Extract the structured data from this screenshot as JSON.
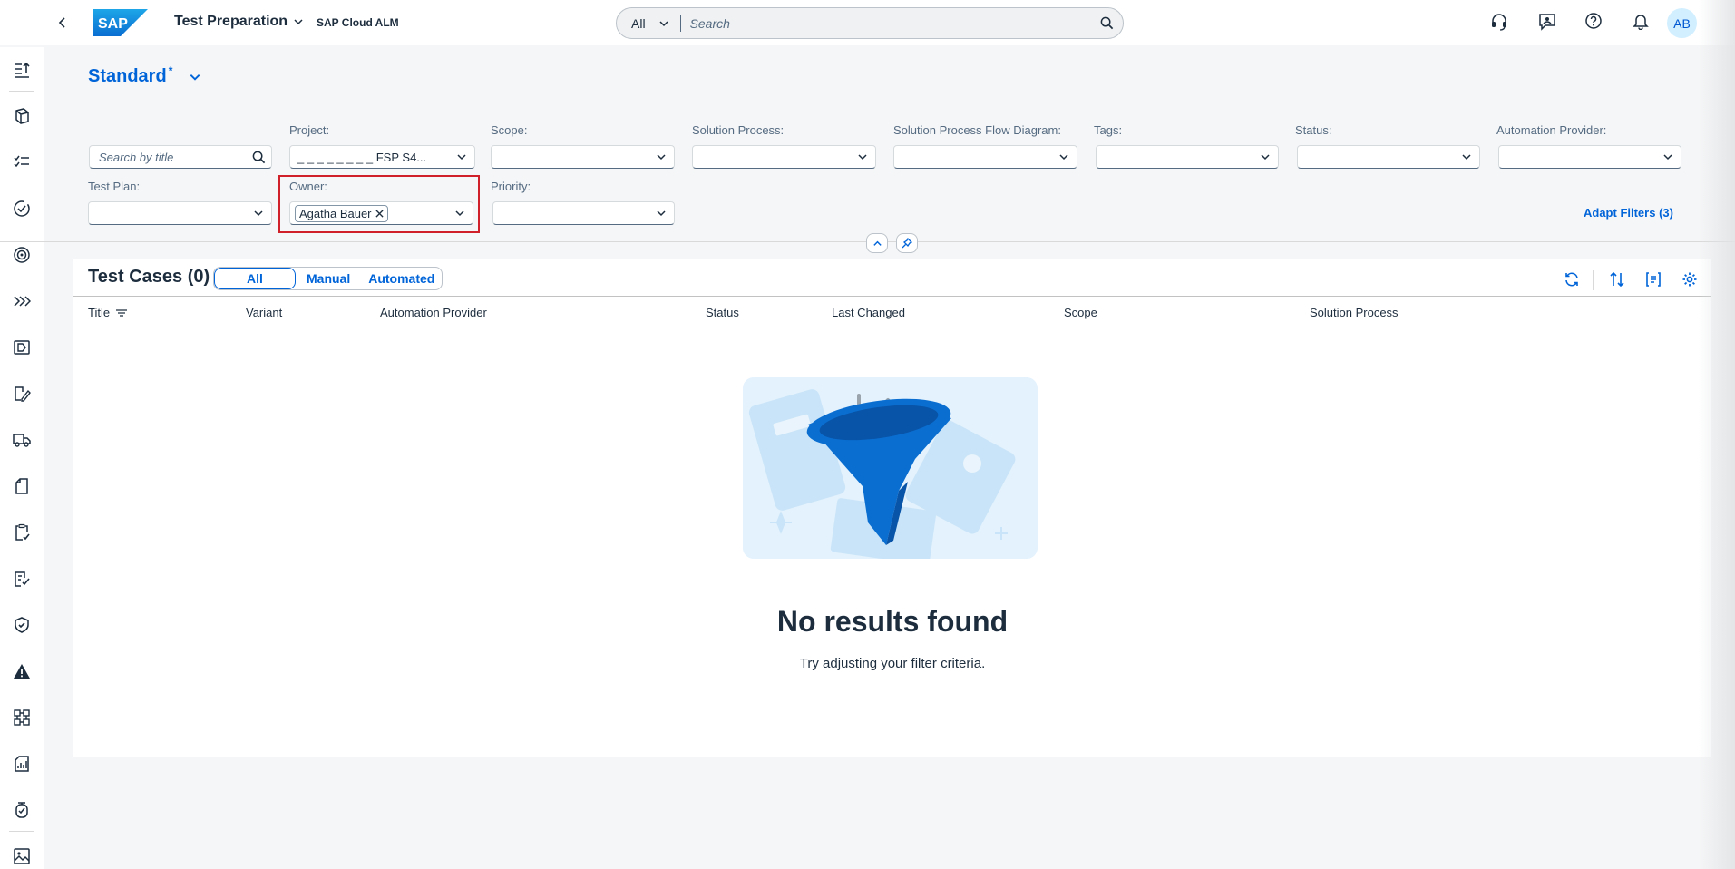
{
  "shell": {
    "title": "Test Preparation",
    "subtitle": "SAP Cloud ALM",
    "logo_text": "SAP",
    "search_scope": "All",
    "search_placeholder": "Search",
    "avatar_initials": "AB"
  },
  "variant": {
    "name": "Standard",
    "modified_marker": "*"
  },
  "filters": {
    "search_placeholder": "Search by title",
    "project": {
      "label": "Project:",
      "value": "_ _ _ _ _ _ _ _ FSP S4..."
    },
    "scope": {
      "label": "Scope:",
      "value": ""
    },
    "solution_process": {
      "label": "Solution Process:",
      "value": ""
    },
    "flow_diagram": {
      "label": "Solution Process Flow Diagram:",
      "value": ""
    },
    "tags": {
      "label": "Tags:",
      "value": ""
    },
    "status": {
      "label": "Status:",
      "value": ""
    },
    "automation_provider": {
      "label": "Automation Provider:",
      "value": ""
    },
    "test_plan": {
      "label": "Test Plan:",
      "value": ""
    },
    "owner": {
      "label": "Owner:",
      "token": "Agatha Bauer"
    },
    "priority": {
      "label": "Priority:",
      "value": ""
    },
    "adapt_label": "Adapt Filters (3)"
  },
  "table": {
    "title": "Test Cases (0)",
    "segments": [
      "All",
      "Manual",
      "Automated"
    ],
    "selected_segment": "All",
    "columns": [
      "Title",
      "Variant",
      "Automation Provider",
      "Status",
      "Last Changed",
      "Scope",
      "Solution Process"
    ],
    "rows": [],
    "empty_title": "No results found",
    "empty_subtitle": "Try adjusting your filter criteria."
  },
  "icons": {
    "shell": [
      "headset-icon",
      "feedback-icon",
      "help-icon",
      "notification-bell-icon"
    ],
    "toolbar": [
      "refresh-icon",
      "sort-icon",
      "group-icon",
      "settings-icon"
    ],
    "nav": [
      "overview-icon",
      "projects-icon",
      "tasks-icon",
      "process-icon",
      "goals-icon",
      "expand-icon",
      "requirements-icon",
      "documents-edit-icon",
      "transport-icon",
      "document-icon",
      "test-clipboard-icon",
      "test-execution-icon",
      "quality-shield-icon",
      "alert-icon",
      "analytics-icon",
      "reports-icon",
      "timer-icon",
      "image-icon"
    ]
  },
  "colors": {
    "brand": "#0064d9",
    "highlight_border": "#d0202a",
    "illustration_blue": "#0a6ed1"
  }
}
